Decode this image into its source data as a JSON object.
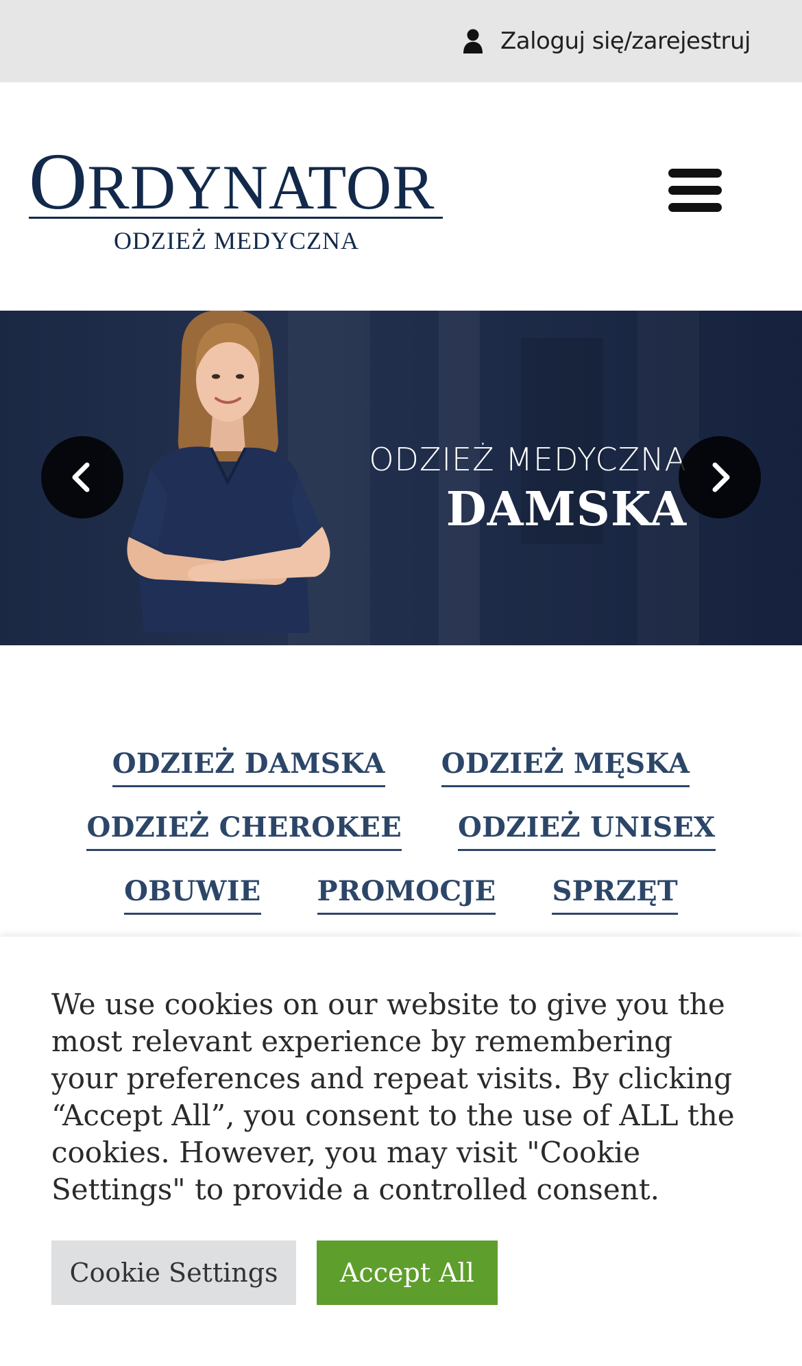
{
  "topbar": {
    "login_label": "Zaloguj się/zarejestruj",
    "icon": "user-icon"
  },
  "header": {
    "logo": {
      "main_first": "O",
      "main_rest": "RDYNATOR",
      "sub": "ODZIEŻ MEDYCZNA"
    },
    "menu_icon": "hamburger-icon"
  },
  "hero": {
    "line1": "ODZIEŻ MEDYCZNA",
    "line2": "DAMSKA",
    "prev_icon": "chevron-left-icon",
    "next_icon": "chevron-right-icon"
  },
  "categories": {
    "row1": [
      "ODZIEŻ DAMSKA",
      "ODZIEŻ MĘSKA"
    ],
    "row2": [
      "ODZIEŻ CHEROKEE",
      "ODZIEŻ UNISEX"
    ],
    "row3": [
      "OBUWIE",
      "PROMOCJE",
      "SPRZĘT"
    ]
  },
  "cookie": {
    "text": "We use cookies on our website to give you the most relevant experience by remembering your preferences and repeat visits. By clicking “Accept All”, you consent to the use of ALL the cookies. However, you may visit \"Cookie Settings\" to provide a controlled consent.",
    "settings_label": "Cookie Settings",
    "accept_label": "Accept All"
  },
  "colors": {
    "brand_navy": "#13294b",
    "link_blue": "#2c4668",
    "accept_green": "#5e9e2c",
    "topbar_gray": "#e6e6e6"
  }
}
